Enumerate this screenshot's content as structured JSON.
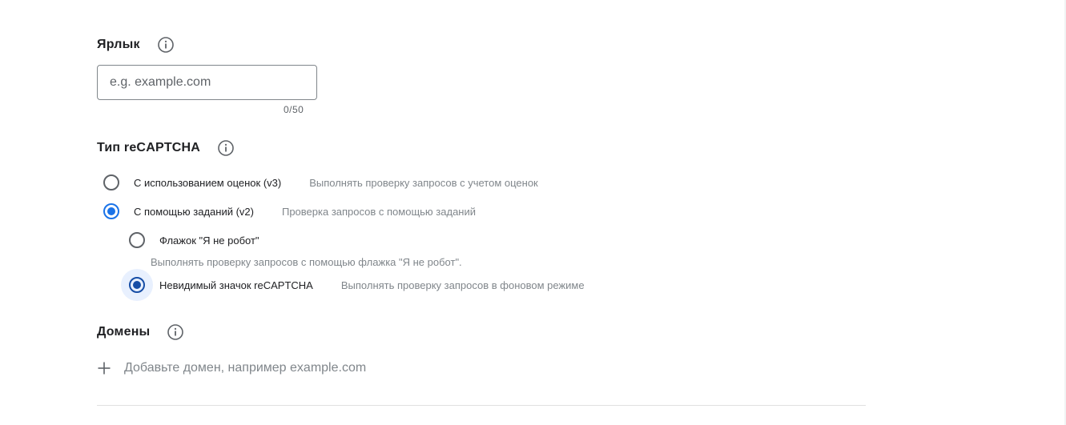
{
  "label_section": {
    "title": "Ярлык",
    "input_placeholder": "e.g. example.com",
    "input_value": "",
    "counter": "0/50",
    "info_icon": "info-icon"
  },
  "recaptcha_section": {
    "title": "Тип reCAPTCHA",
    "info_icon": "info-icon",
    "options": [
      {
        "label": "С использованием оценок (v3)",
        "description": "Выполнять проверку запросов с учетом оценок",
        "checked": false
      },
      {
        "label": "С помощью заданий (v2)",
        "description": "Проверка запросов с помощью заданий",
        "checked": true
      }
    ],
    "sub_options": [
      {
        "label": "Флажок \"Я не робот\"",
        "description": "Выполнять проверку запросов с помощью флажка \"Я не робот\".",
        "checked": false
      },
      {
        "label": "Невидимый значок reCAPTCHA",
        "description": "Выполнять проверку запросов в фоновом режиме",
        "checked": true
      }
    ]
  },
  "domains_section": {
    "title": "Домены",
    "info_icon": "info-icon",
    "add_icon": "plus-icon",
    "add_placeholder": "Добавьте домен, например example.com"
  },
  "colors": {
    "accent": "#1a73e8",
    "accent_dark": "#174ea6",
    "focus_halo": "#e8f0fe",
    "text_primary": "#202124",
    "text_secondary": "#80868b"
  }
}
